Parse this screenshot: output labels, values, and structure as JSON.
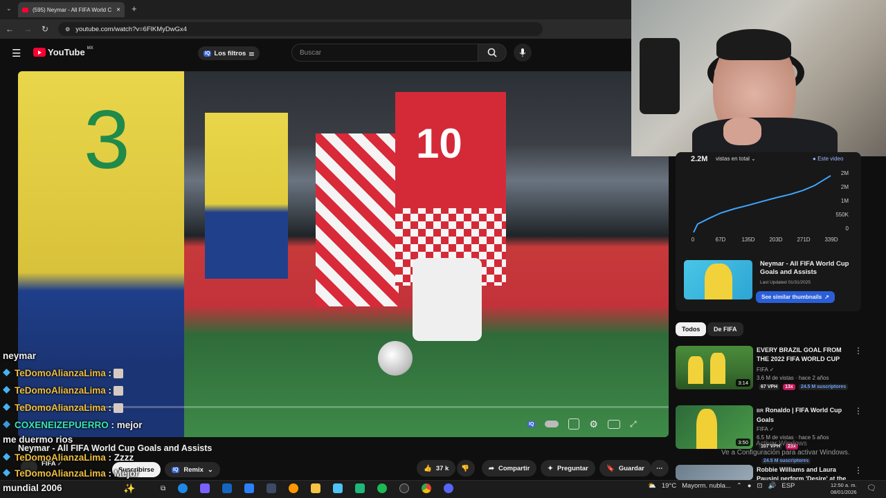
{
  "browser": {
    "tab_title": "(595) Neymar - All FIFA World C",
    "url": "youtube.com/watch?v=6FlKMyDwGx4"
  },
  "youtube": {
    "logo": "YouTube",
    "region": "MX",
    "filters_label": "Los filtros",
    "filters_badge": "IQ",
    "search_placeholder": "Buscar"
  },
  "video": {
    "title": "Neymar - All FIFA World Cup Goals and Assists",
    "channel": "FIFA",
    "subscribe_label": "Suscribirse",
    "remix_label": "Remix",
    "likes": "37 k",
    "share_label": "Compartir",
    "ask_label": "Preguntar",
    "save_label": "Guardar",
    "jersey_numbers": [
      "3",
      "10"
    ]
  },
  "stats": {
    "total_views": "2.2M",
    "total_label": "vistas en total",
    "legend": "Este video",
    "y_ticks": [
      "2M",
      "2M",
      "1M",
      "550K",
      "0"
    ],
    "x_ticks": [
      "0",
      "67D",
      "135D",
      "203D",
      "271D",
      "339D"
    ]
  },
  "chart_data": {
    "type": "line",
    "title": "",
    "series": [
      {
        "name": "Este video",
        "x": [
          0,
          10,
          40,
          67,
          100,
          135,
          170,
          203,
          240,
          271,
          300,
          320,
          339
        ],
        "y": [
          0,
          300000,
          520000,
          700000,
          850000,
          980000,
          1120000,
          1250000,
          1380000,
          1520000,
          1700000,
          1880000,
          2050000
        ]
      }
    ],
    "xlabel": "",
    "ylabel": "",
    "xlim": [
      0,
      339
    ],
    "ylim": [
      0,
      2200000
    ],
    "x_tick_labels": [
      "0",
      "67D",
      "135D",
      "203D",
      "271D",
      "339D"
    ],
    "y_tick_labels": [
      "2M",
      "2M",
      "1M",
      "550K",
      "0"
    ],
    "grid": false,
    "legend": "top-right",
    "color": "#3ea6ff"
  },
  "card": {
    "title": "Neymar - All FIFA World Cup Goals and Assists",
    "updated": "Last Updated 01/31/2025",
    "button_label": "See similar thumbnails"
  },
  "chips": [
    "Todos",
    "De FIFA"
  ],
  "related": [
    {
      "title": "EVERY BRAZIL GOAL FROM THE 2022 FIFA WORLD CUP",
      "channel": "FIFA",
      "meta": "3.6 M de vistas · hace 2 años",
      "duration": "3:14",
      "vph": "67 VPH",
      "mult": "13x",
      "subs": "24.5 M suscriptores"
    },
    {
      "title": "Ronaldo | FIFA World Cup Goals",
      "flag": "BR",
      "channel": "FIFA",
      "meta": "6.5 M de vistas · hace 5 años",
      "duration": "3:50",
      "vph": "107 VPH",
      "mult": "23x",
      "subs": "24.5 M suscriptores"
    },
    {
      "title": "Robbie Williams and Laura Pausini perform 'Desire' at the",
      "channel": "",
      "meta": "",
      "duration": "",
      "vph": "",
      "mult": "",
      "subs": ""
    }
  ],
  "chat": [
    {
      "user": "",
      "msg": "neymar"
    },
    {
      "user": "TeDomoAlianzaLima",
      "msg": ":"
    },
    {
      "user": "TeDomoAlianzaLima",
      "msg": ":"
    },
    {
      "user": "TeDomoAlianzaLima",
      "msg": ":"
    },
    {
      "user": "COXENEIZEPUERRO",
      "msg": ": mejor"
    },
    {
      "user": "",
      "msg": "me duermo rios"
    },
    {
      "user": "TeDomoAlianzaLima",
      "msg": ": Zzzz"
    },
    {
      "user": "TeDomoAlianzaLima",
      "msg": ": Mejor"
    },
    {
      "user": "",
      "msg": "mundial 2006"
    }
  ],
  "watermark": {
    "line1": "Activar Windows",
    "line2": "Ve a Configuración para activar Windows."
  },
  "taskbar": {
    "weather": "19°C",
    "weather_desc": "Mayorm. nubla...",
    "lang": "ESP",
    "time": "12:50 a. m.",
    "date": "08/01/2026"
  }
}
